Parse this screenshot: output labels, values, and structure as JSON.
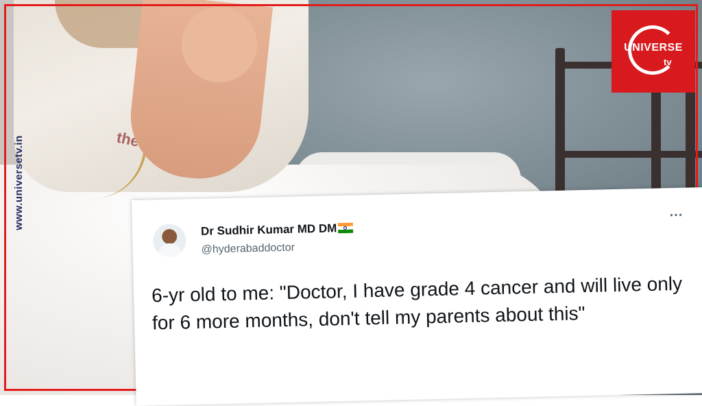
{
  "watermark": {
    "site": "www.universetv.in"
  },
  "logo": {
    "name": "UNIVERSE",
    "suffix": "tv",
    "color": "#d8191d"
  },
  "tweet": {
    "author_name": "Dr Sudhir Kumar MD DM",
    "author_flag": "india-flag-icon",
    "handle": "@hyderabaddoctor",
    "more_label": "...",
    "text": "6-yr old to me: \"Doctor, I have grade 4 cancer and will live only for 6 more months, don't tell my parents about this\""
  },
  "colors": {
    "border": "#e31b1b",
    "site_text": "#232a63"
  }
}
